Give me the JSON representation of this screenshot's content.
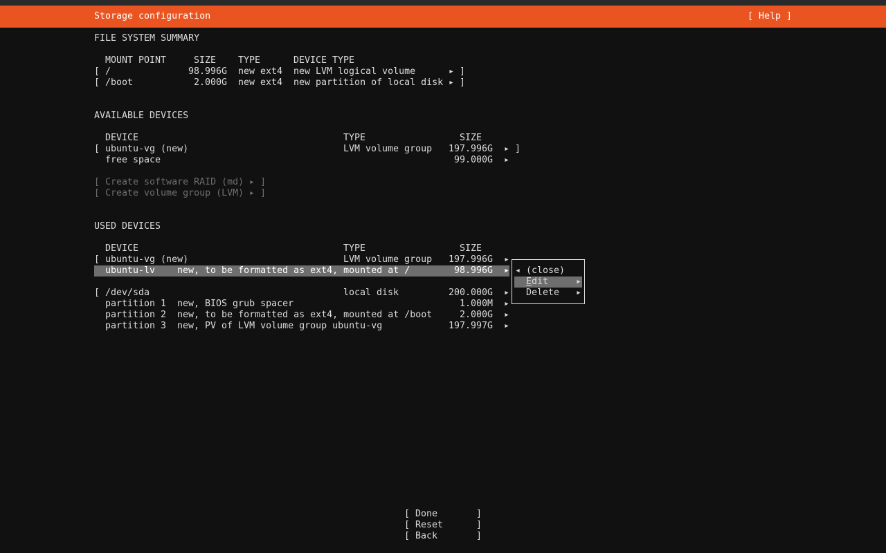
{
  "header": {
    "title": "Storage configuration",
    "help": "[ Help ]"
  },
  "fs_summary": {
    "title": "FILE SYSTEM SUMMARY",
    "columns": [
      "MOUNT POINT",
      "SIZE",
      "TYPE",
      "DEVICE TYPE"
    ],
    "rows": [
      {
        "mount": "/",
        "size": "98.996G",
        "type": "new ext4",
        "device_type": "new LVM logical volume"
      },
      {
        "mount": "/boot",
        "size": "2.000G",
        "type": "new ext4",
        "device_type": "new partition of local disk"
      }
    ]
  },
  "available": {
    "title": "AVAILABLE DEVICES",
    "columns": [
      "DEVICE",
      "TYPE",
      "SIZE"
    ],
    "rows": [
      {
        "device": "ubuntu-vg (new)",
        "type": "LVM volume group",
        "size": "197.996G"
      },
      {
        "device": "free space",
        "type": "",
        "size": "99.000G"
      }
    ],
    "actions": [
      "Create software RAID (md)",
      "Create volume group (LVM)"
    ]
  },
  "used": {
    "title": "USED DEVICES",
    "columns": [
      "DEVICE",
      "TYPE",
      "SIZE"
    ],
    "vg_row": {
      "device": "ubuntu-vg (new)",
      "type": "LVM volume group",
      "size": "197.996G"
    },
    "lv_row": {
      "device": "ubuntu-lv",
      "desc": "new, to be formatted as ext4, mounted at /",
      "size": "98.996G"
    },
    "disk_row": {
      "device": "/dev/sda",
      "type": "local disk",
      "size": "200.000G"
    },
    "partitions": [
      {
        "name": "partition 1",
        "desc": "new, BIOS grub spacer",
        "size": "1.000M"
      },
      {
        "name": "partition 2",
        "desc": "new, to be formatted as ext4, mounted at /boot",
        "size": "2.000G"
      },
      {
        "name": "partition 3",
        "desc": "new, PV of LVM volume group ubuntu-vg",
        "size": "197.997G"
      }
    ]
  },
  "popup": {
    "close": "(close)",
    "edit_hotkey": "E",
    "edit_rest": "dit",
    "delete": "Delete"
  },
  "footer": {
    "done": "Done",
    "reset": "Reset",
    "back": "Back"
  },
  "glyphs": {
    "arrow_right": "▸",
    "arrow_left": "◂",
    "bracket_open": "[",
    "bracket_close": "]"
  },
  "colors": {
    "header_bg": "#e95420",
    "background": "#111111",
    "highlight": "#6e6e6e",
    "text": "#dcdcdc",
    "disabled": "#6e6e6e"
  }
}
